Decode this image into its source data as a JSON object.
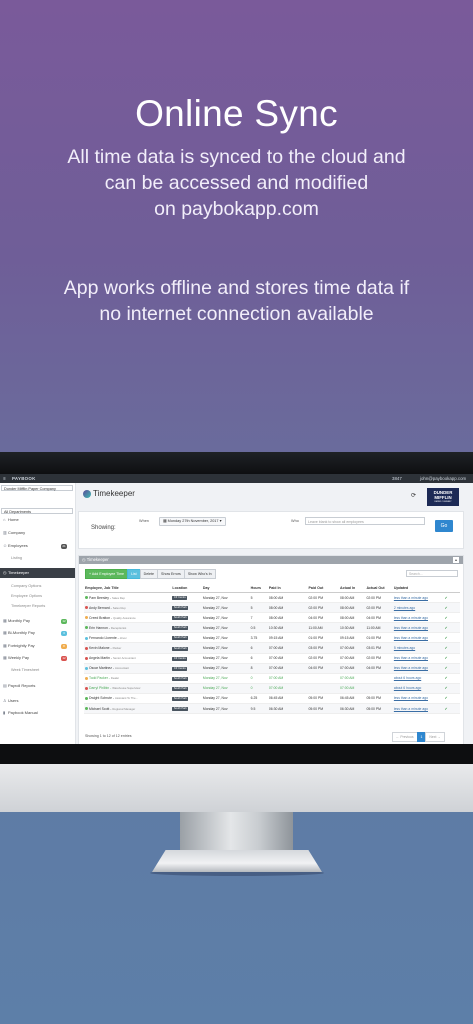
{
  "hero": {
    "title": "Online Sync",
    "para1_line1": "All time data is synced to the cloud and",
    "para1_line2": "can be accessed and modified",
    "para1_line3": "on paybokapp.com",
    "para2_line1": "App works offline and stores time data if",
    "para2_line2": "no internet connection available"
  },
  "app": {
    "brand": "PAYBOOK",
    "menu_icon": "hamburger-icon",
    "topbar_right1": "3847",
    "topbar_right2": "john@paybookapp.com",
    "company_select": "Dunder Mifflin Paper Company",
    "departments_select": "All Departments",
    "sidebar": [
      {
        "label": "Home",
        "icon": "home-icon",
        "sub": false
      },
      {
        "label": "Company",
        "icon": "building-icon",
        "sub": false
      },
      {
        "label": "Employees",
        "icon": "users-icon",
        "sub": false,
        "badge": "21",
        "badge_color": "#555"
      },
      {
        "label": "Listing",
        "icon": "",
        "sub": true
      },
      {
        "label": "Timekeeper",
        "icon": "clock-icon",
        "sub": false,
        "active": true
      },
      {
        "label": "Company Options",
        "icon": "",
        "sub": true
      },
      {
        "label": "Employee Options",
        "icon": "",
        "sub": true
      },
      {
        "label": "Timekeeper Reports",
        "icon": "",
        "sub": true
      },
      {
        "label": "Monthly Pay",
        "icon": "calendar-icon",
        "sub": false,
        "badge": "12",
        "badge_color": "#5cb85c"
      },
      {
        "label": "Bi-Monthly Pay",
        "icon": "calendar-icon",
        "sub": false,
        "badge": "3",
        "badge_color": "#5bc0de"
      },
      {
        "label": "Fortnightly Pay",
        "icon": "calendar-icon",
        "sub": false,
        "badge": "8",
        "badge_color": "#f0ad4e"
      },
      {
        "label": "Weekly Pay",
        "icon": "calendar-icon",
        "sub": false,
        "badge": "12",
        "badge_color": "#d9534f"
      },
      {
        "label": "Week Timesheet",
        "icon": "",
        "sub": true
      },
      {
        "label": "Payroll Reports",
        "icon": "report-icon",
        "sub": false
      },
      {
        "label": "Users",
        "icon": "user-icon",
        "sub": false
      },
      {
        "label": "Paybook Manual",
        "icon": "book-icon",
        "sub": false
      }
    ],
    "header_title": "Timekeeper",
    "logo_line1": "DUNDER",
    "logo_line2": "MIFFLIN",
    "logo_line3": "PAPER COMPANY",
    "showing_label": "Showing:",
    "when_label": "When",
    "date_value": "Monday 27th November, 2017",
    "who_label": "Who",
    "who_placeholder": "Leave blank to show all employees",
    "go_label": "Go",
    "panel_title": "Timekeeper",
    "buttons": {
      "add": "+ Add Employee Time",
      "list": "List",
      "delete": "Delete",
      "errors": "Show Errors",
      "whos_in": "Show Who's In"
    },
    "search_placeholder": "Search...",
    "columns": [
      "Employee, Job Title",
      "",
      "Location",
      "Day",
      "Hours",
      "Paid In",
      "Paid Out",
      "Actual In",
      "Actual Out",
      "Updated",
      "",
      ""
    ],
    "rows": [
      {
        "name": "Pam Beesley",
        "role": "Sales Rep",
        "color": "#5cb85c",
        "loc": "CZ Centre",
        "day": "Monday 27, Nov",
        "hours": "5",
        "paid_in": "08:00 AM",
        "paid_out": "02:00 PM",
        "actual_in": "08:00 AM",
        "actual_out": "02:00 PM",
        "updated": "less than a minute ago",
        "green": false
      },
      {
        "name": "Andy Bernard",
        "role": "Sales Rep",
        "color": "#d9534f",
        "loc": "South Park",
        "day": "Monday 27, Nov",
        "hours": "5",
        "paid_in": "08:00 AM",
        "paid_out": "02:00 PM",
        "actual_in": "08:00 AM",
        "actual_out": "02:00 PM",
        "updated": "2 minutes ago",
        "green": false
      },
      {
        "name": "Creed Bratton",
        "role": "Quality Assurance",
        "color": "#f0ad4e",
        "loc": "South Park",
        "day": "Monday 27, Nov",
        "hours": "7",
        "paid_in": "08:00 AM",
        "paid_out": "04:00 PM",
        "actual_in": "08:00 AM",
        "actual_out": "04:00 PM",
        "updated": "less than a minute ago",
        "green": false
      },
      {
        "name": "Erin Hannon",
        "role": "Receptionist",
        "color": "#5cb85c",
        "loc": "South Park",
        "day": "Monday 27, Nov",
        "hours": "0.5",
        "paid_in": "10:30 AM",
        "paid_out": "11:00 AM",
        "actual_in": "10:30 AM",
        "actual_out": "11:00 AM",
        "updated": "less than a minute ago",
        "green": false
      },
      {
        "name": "Fernando Llorente",
        "role": "driver",
        "color": "#5bc0de",
        "loc": "South Park",
        "day": "Monday 27, Nov",
        "hours": "3.75",
        "paid_in": "09:15 AM",
        "paid_out": "01:00 PM",
        "actual_in": "09:15 AM",
        "actual_out": "01:00 PM",
        "updated": "less than a minute ago",
        "green": false
      },
      {
        "name": "Kevin Malone",
        "role": "Packer",
        "color": "#d9534f",
        "loc": "South Park",
        "day": "Monday 27, Nov",
        "hours": "6",
        "paid_in": "07:00 AM",
        "paid_out": "03:00 PM",
        "actual_in": "07:00 AM",
        "actual_out": "03:01 PM",
        "updated": "5 minutes ago",
        "green": false
      },
      {
        "name": "Angela Martin",
        "role": "Senior Accountant",
        "color": "#d9534f",
        "loc": "CZ Centre",
        "day": "Monday 27, Nov",
        "hours": "6",
        "paid_in": "07:00 AM",
        "paid_out": "02:00 PM",
        "actual_in": "07:00 AM",
        "actual_out": "02:00 PM",
        "updated": "less than a minute ago",
        "green": false
      },
      {
        "name": "Oscar Martinez",
        "role": "Accountant",
        "color": "#5bc0de",
        "loc": "CZ Centre",
        "day": "Monday 27, Nov",
        "hours": "8",
        "paid_in": "07:00 AM",
        "paid_out": "04:00 PM",
        "actual_in": "07:00 AM",
        "actual_out": "04:00 PM",
        "updated": "less than a minute ago",
        "green": false
      },
      {
        "name": "Todd Packer",
        "role": "Dealer",
        "color": "#f0ad4e",
        "loc": "South Park",
        "day": "Monday 27, Nov",
        "hours": "0",
        "paid_in": "07:00 AM",
        "paid_out": "",
        "actual_in": "07:00 AM",
        "actual_out": "",
        "updated": "about 6 hours ago",
        "green": true
      },
      {
        "name": "Darryl Philbin",
        "role": "Warehouse Supervisor",
        "color": "#d9534f",
        "loc": "South Park",
        "day": "Monday 27, Nov",
        "hours": "0",
        "paid_in": "07:00 AM",
        "paid_out": "",
        "actual_in": "07:00 AM",
        "actual_out": "",
        "updated": "about 6 hours ago",
        "green": true
      },
      {
        "name": "Dwight Schrute",
        "role": "Assistant To The...",
        "color": "#5cb85c",
        "loc": "South Park",
        "day": "Monday 27, Nov",
        "hours": "6.25",
        "paid_in": "06:45 AM",
        "paid_out": "05:00 PM",
        "actual_in": "06:45 AM",
        "actual_out": "05:00 PM",
        "updated": "less than a minute ago",
        "green": false
      },
      {
        "name": "Michael Scott",
        "role": "Regional Manager",
        "color": "#5cb85c",
        "loc": "South Park",
        "day": "Monday 27, Nov",
        "hours": "9.5",
        "paid_in": "06:30 AM",
        "paid_out": "05:00 PM",
        "actual_in": "06:30 AM",
        "actual_out": "05:00 PM",
        "updated": "less than a minute ago",
        "green": false
      }
    ],
    "footer_text": "Showing 1 to 12 of 12 entries",
    "pager": {
      "prev": "← Previous",
      "page": "1",
      "next": "Next →"
    }
  }
}
